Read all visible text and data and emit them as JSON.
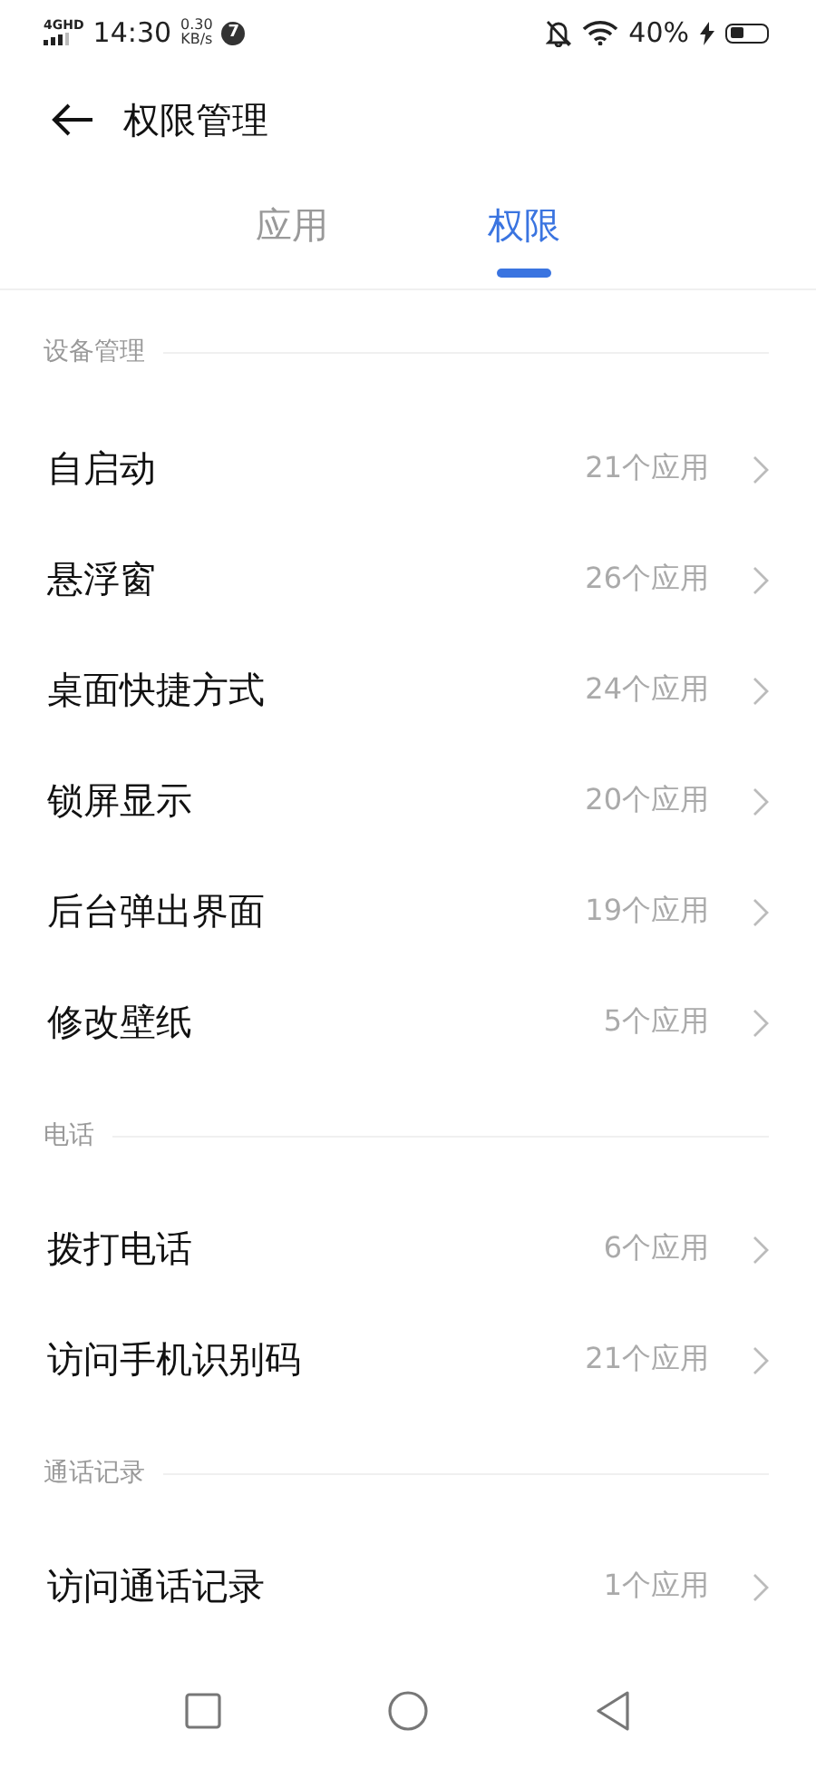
{
  "status_bar": {
    "network": "4G",
    "network_extra": "HD",
    "time": "14:30",
    "speed_value": "0.30",
    "speed_unit": "KB/s",
    "notification_count": "7",
    "battery": "40%",
    "charging": true
  },
  "header": {
    "title": "权限管理"
  },
  "tabs": [
    {
      "label": "应用",
      "selected": false
    },
    {
      "label": "权限",
      "selected": true
    }
  ],
  "sections": [
    {
      "title": "设备管理",
      "items": [
        {
          "label": "自启动",
          "count": "21个应用"
        },
        {
          "label": "悬浮窗",
          "count": "26个应用"
        },
        {
          "label": "桌面快捷方式",
          "count": "24个应用"
        },
        {
          "label": "锁屏显示",
          "count": "20个应用"
        },
        {
          "label": "后台弹出界面",
          "count": "19个应用"
        },
        {
          "label": "修改壁纸",
          "count": "5个应用"
        }
      ]
    },
    {
      "title": "电话",
      "items": [
        {
          "label": "拨打电话",
          "count": "6个应用"
        },
        {
          "label": "访问手机识别码",
          "count": "21个应用"
        }
      ]
    },
    {
      "title": "通话记录",
      "items": [
        {
          "label": "访问通话记录",
          "count": "1个应用"
        }
      ]
    }
  ]
}
